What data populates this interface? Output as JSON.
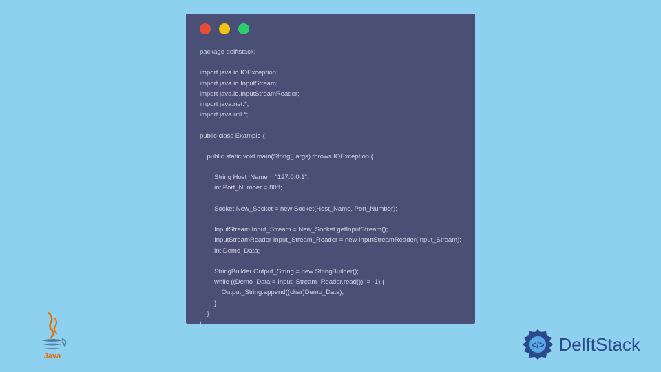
{
  "code": {
    "content": "package delftstack;\n\nimport java.io.IOException;\nimport java.io.InputStream;\nimport java.io.InputStreamReader;\nimport java.net.*;\nimport java.util.*;\n\npublic class Example {\n\n    public static void main(String[] args) throws IOException {\n\n        String Host_Name = \"127.0.0.1\";\n        int Port_Number = 808;\n\n        Socket New_Socket = new Socket(Host_Name, Port_Number);\n\n        InputStream Input_Stream = New_Socket.getInputStream();\n        InputStreamReader Input_Stream_Reader = new InputStreamReader(Input_Stream);\n        int Demo_Data;\n\n        StringBuilder Output_String = new StringBuilder();\n        while ((Demo_Data = Input_Stream_Reader.read()) != -1) {\n            Output_String.append((char)Demo_Data);\n        }\n    }\n}"
  },
  "branding": {
    "java_label": "Java",
    "delftstack_label": "DelftStack"
  }
}
